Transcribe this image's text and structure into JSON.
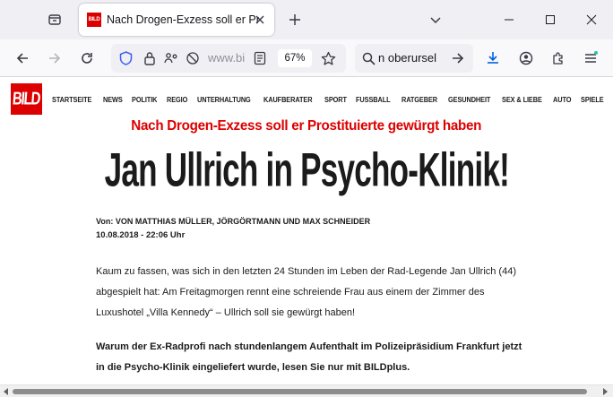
{
  "browser": {
    "tab": {
      "favicon": "BILD",
      "title": "Nach Drogen-Exzess soll er Prostituierte gewürgt haben"
    },
    "url_text": "www.bild.de",
    "zoom": "67%",
    "search_text": "n oberursel"
  },
  "site": {
    "logo": "BILD",
    "nav": [
      "STARTSEITE",
      "NEWS",
      "POLITIK",
      "REGIO",
      "UNTERHALTUNG",
      "KAUFBERATER",
      "SPORT",
      "FUSSBALL",
      "RATGEBER",
      "GESUNDHEIT",
      "SEX & LIEBE",
      "AUTO",
      "SPIELE"
    ]
  },
  "article": {
    "kicker": "Nach Drogen-Exzess soll er Prostituierte gewürgt haben",
    "headline": "Jan Ullrich in Psycho-Klinik!",
    "byline": "Von: VON MATTHIAS MÜLLER, JÖRGÖRTMANN UND MAX SCHNEIDER",
    "date": "10.08.2018 - 22:06 Uhr",
    "lead": "Kaum zu fassen, was sich in den letzten 24 Stunden im Leben der Rad-Legende Jan Ullrich (44) abgespielt hat: Am Freitagmorgen rennt eine schreiende Frau aus einem der Zimmer des Luxushotel „Villa Kennedy“ – Ullrich soll sie gewürgt haben!",
    "teaser": "Warum der Ex-Radprofi nach stundenlangem Aufenthalt im Polizeipräsidium Frankfurt jetzt in die Psycho-Klinik eingeliefert wurde, lesen Sie nur mit BILDplus."
  },
  "colors": {
    "brand_red": "#dd0000",
    "text": "#1b1b1b",
    "chrome": "#f0f0f4"
  }
}
